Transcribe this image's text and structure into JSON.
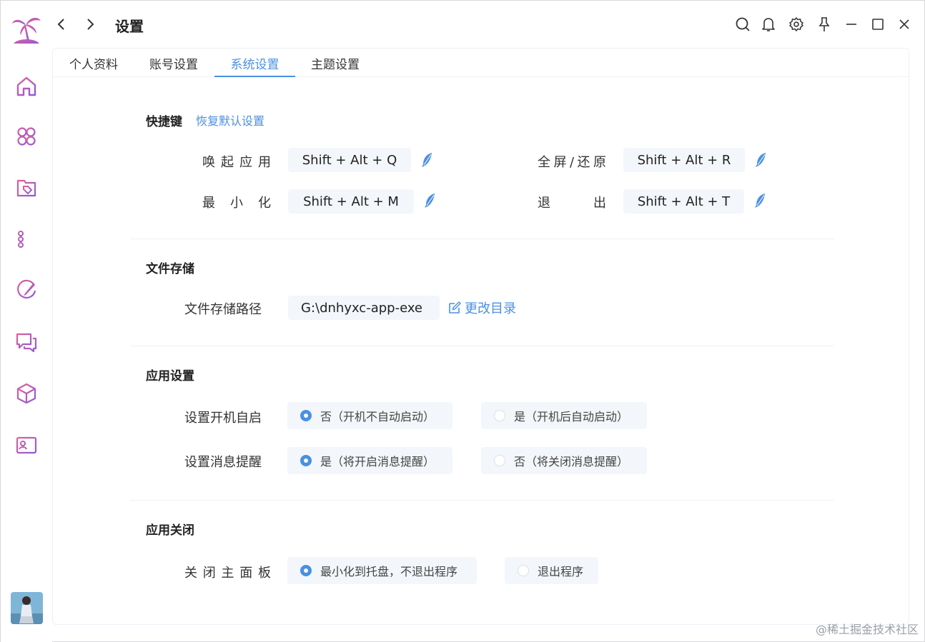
{
  "app": {
    "title": "设置"
  },
  "sidebar": {
    "items": [
      {
        "name": "home-icon"
      },
      {
        "name": "apps-icon"
      },
      {
        "name": "folder-tag-icon"
      },
      {
        "name": "list-settings-icon"
      },
      {
        "name": "brush-icon"
      },
      {
        "name": "chat-icon"
      },
      {
        "name": "cube-icon"
      },
      {
        "name": "id-card-icon"
      }
    ]
  },
  "tabs": [
    {
      "label": "个人资料",
      "active": false
    },
    {
      "label": "账号设置",
      "active": false
    },
    {
      "label": "系统设置",
      "active": true
    },
    {
      "label": "主题设置",
      "active": false
    }
  ],
  "shortcuts": {
    "title": "快捷键",
    "reset_label": "恢复默认设置",
    "items": [
      {
        "label": "唤起应用",
        "keys": "Shift + Alt + Q"
      },
      {
        "label": "全屏/还原",
        "keys": "Shift + Alt + R"
      },
      {
        "label": "最小化",
        "keys": "Shift + Alt + M"
      },
      {
        "label": "退出",
        "keys": "Shift + Alt + T"
      }
    ]
  },
  "storage": {
    "title": "文件存储",
    "path_label": "文件存储路径",
    "path_value": "G:\\dnhyxc-app-exe",
    "change_label": "更改目录"
  },
  "app_settings": {
    "title": "应用设置",
    "autostart": {
      "label": "设置开机自启",
      "options": [
        {
          "label": "否（开机不自动启动）",
          "checked": true
        },
        {
          "label": "是（开机后自动启动）",
          "checked": false
        }
      ]
    },
    "notify": {
      "label": "设置消息提醒",
      "options": [
        {
          "label": "是（将开启消息提醒）",
          "checked": true
        },
        {
          "label": "否（将关闭消息提醒）",
          "checked": false
        }
      ]
    }
  },
  "close_settings": {
    "title": "应用关闭",
    "label": "关闭主面板",
    "options": [
      {
        "label": "最小化到托盘，不退出程序",
        "checked": true
      },
      {
        "label": "退出程序",
        "checked": false
      }
    ]
  },
  "watermark": "@稀土掘金技术社区",
  "colors": {
    "accent": "#4a90e2",
    "brand_gradient_start": "#e0609a",
    "brand_gradient_end": "#8e5ad8"
  }
}
